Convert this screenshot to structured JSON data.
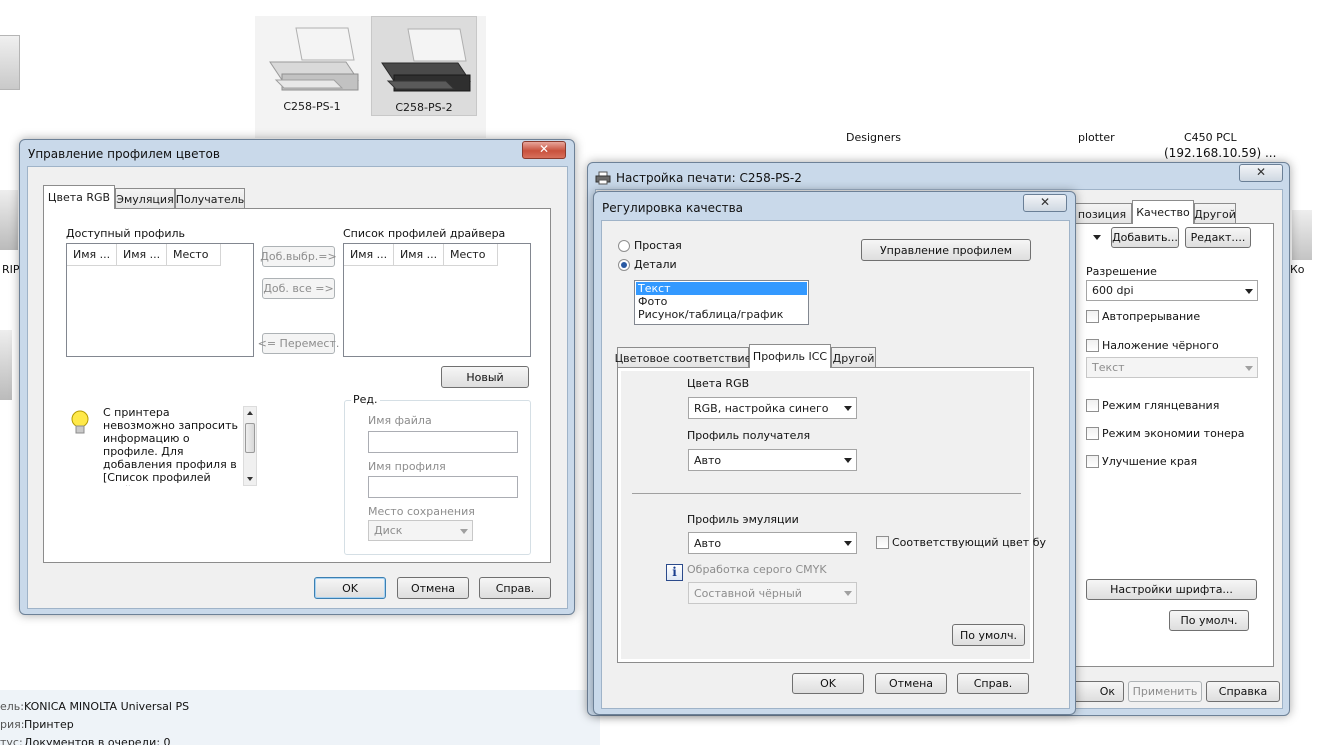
{
  "desktop": {
    "printers": [
      {
        "name": "C258-PS-1"
      },
      {
        "name": "C258-PS-2"
      }
    ],
    "bg_text": {
      "designers": "Designers",
      "plotter": "plotter",
      "c450": "C450 PCL",
      "ip": "(192.168.10.59) ...",
      "rip": "RIP",
      "ko": "Ко"
    },
    "status": [
      {
        "label": "ель:",
        "value": "KONICA MINOLTA Universal PS"
      },
      {
        "label": "рия:",
        "value": "Принтер"
      },
      {
        "label": "тус:",
        "value": "Документов в очереди: 0"
      }
    ]
  },
  "color_profile_dialog": {
    "title": "Управление профилем цветов",
    "close": "✕",
    "tabs": [
      "Цвета RGB",
      "Эмуляция",
      "Получатель"
    ],
    "available_profile_label": "Доступный профиль",
    "driver_list_label": "Список профилей драйвера",
    "columns": [
      "Имя ...",
      "Имя ...",
      "Место"
    ],
    "btn_add_selected": "Доб.выбр.=>",
    "btn_add_all": "Доб. все =>",
    "btn_move": "<= Перемест.",
    "btn_new": "Новый",
    "info_text": "С принтера невозможно запросить информацию о профиле. Для добавления профиля в [Список профилей драйвера], нажмите кнопку [Новый] и",
    "edit_group": "Ред.",
    "filename_label": "Имя файла",
    "profile_name_label": "Имя профиля",
    "save_location_label": "Место сохранения",
    "save_location_value": "Диск",
    "ok": "OK",
    "cancel": "Отмена",
    "help": "Справ."
  },
  "print_settings_dialog": {
    "title": "Настройка печати: C258-PS-2",
    "close": "✕",
    "tabs": [
      "позиция",
      "Качество",
      "Другой"
    ],
    "btn_add": "Добавить...",
    "btn_edit": "Редакт....",
    "resolution_label": "Разрешение",
    "resolution_value": "600 dpi",
    "auto_trapping": "Автопрерывание",
    "black_overprint": "Наложение чёрного",
    "overprint_value": "Текст",
    "glossy_mode": "Режим глянцевания",
    "toner_save": "Режим экономии тонера",
    "edge_enhance": "Улучшение края",
    "font_settings": "Настройки шрифта...",
    "defaults": "По умолч.",
    "ok_partial": "Ок",
    "apply": "Применить",
    "help": "Справка"
  },
  "quality_dialog": {
    "title": "Регулировка качества",
    "close": "✕",
    "radio_simple": "Простая",
    "radio_detail": "Детали",
    "manage_profile": "Управление профилем",
    "object_types": [
      "Текст",
      "Фото",
      "Рисунок/таблица/график"
    ],
    "tabs": [
      "Цветовое соответствие",
      "Профиль ICC",
      "Другой"
    ],
    "rgb_colors_label": "Цвета RGB",
    "rgb_colors_value": "RGB, настройка синего",
    "dest_profile_label": "Профиль получателя",
    "dest_profile_value": "Авто",
    "emulation_label": "Профиль эмуляции",
    "emulation_value": "Авто",
    "match_color": "Соответствующий цвет бу",
    "cmyk_gray_label": "Обработка серого CMYK",
    "cmyk_gray_value": "Составной чёрный",
    "defaults": "По умолч.",
    "ok": "OK",
    "cancel": "Отмена",
    "help": "Справ."
  }
}
